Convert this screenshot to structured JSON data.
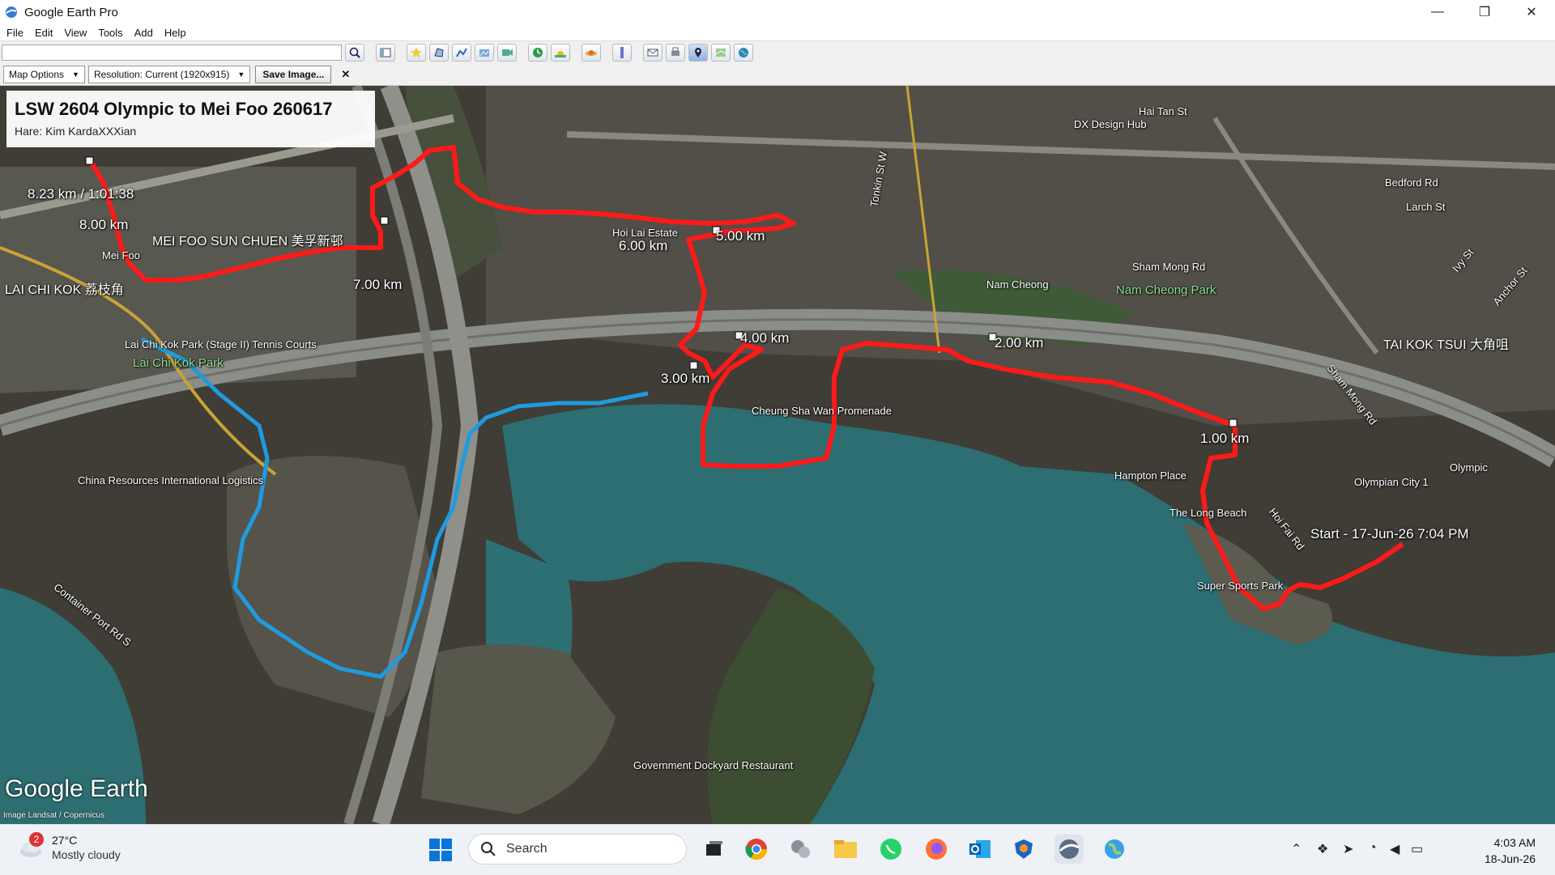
{
  "window": {
    "title": "Google Earth Pro",
    "controls": [
      "—",
      "❐",
      "✕"
    ]
  },
  "menu": [
    "File",
    "Edit",
    "View",
    "Tools",
    "Add",
    "Help"
  ],
  "toolbar": {
    "search_value": "",
    "buttons": [
      "search-icon",
      "sidebar-icon",
      "placemark-icon",
      "polygon-icon",
      "path-icon",
      "overlay-icon",
      "tour-icon",
      "history-icon",
      "sun-icon",
      "planets-icon",
      "ruler-icon",
      "email-icon",
      "print-icon",
      "save-image-icon",
      "maps-icon",
      "earth-icon"
    ]
  },
  "options": {
    "map_options_label": "Map Options",
    "resolution_label": "Resolution: Current (1920x915)",
    "save_label": "Save Image...",
    "close_label": "✕"
  },
  "infobox": {
    "title": "LSW 2604 Olympic to Mei Foo 260617",
    "subtitle": "Hare: Kim KardaXXXian"
  },
  "km_markers": [
    "8.23 km / 1:01:38",
    "8.00 km",
    "7.00 km",
    "6.00 km",
    "5.00 km",
    "4.00 km",
    "3.00 km",
    "2.00 km",
    "1.00 km",
    "Start - 17-Jun-26 7:04 PM"
  ],
  "map_labels": {
    "mei_foo_sun_chuen": "MEI FOO SUN CHUEN 美孚新邨",
    "mei_foo": "Mei Foo",
    "lai_chi_kok": "LAI CHI KOK 荔枝角",
    "lck_tennis": "Lai Chi Kok Park (Stage II) Tennis Courts",
    "lck_park": "Lai Chi Kok Park",
    "hoi_lai": "Hoi Lai Estate",
    "nam_cheong": "Nam Cheong",
    "nam_cheong_park": "Nam Cheong Park",
    "sham_mong": "Sham Mong Rd",
    "csw_promenade": "Cheung Sha Wan Promenade",
    "china_resources": "China Resources International Logistics",
    "container_port": "Container Port Rd S",
    "hampton": "Hampton Place",
    "long_beach": "The Long Beach",
    "super_sports": "Super Sports Park",
    "olympian_city": "Olympian City 1",
    "olympic": "Olympic",
    "tai_kok_tsui": "TAI KOK TSUI 大角咀",
    "bedford": "Bedford Rd",
    "larch": "Larch St",
    "dx_design": "DX Design Hub",
    "tai_tsun": "Hai Tan St",
    "govt_dockyard": "Government Dockyard Restaurant",
    "hoi_fai": "Hoi Fai Rd",
    "sham_mong_rd2": "Sham Mong Rd",
    "tonkin": "Tonkin St W",
    "anchor": "Anchor St",
    "ivy": "Ivy St"
  },
  "branding": {
    "logo": "Google Earth",
    "attribution": "Image Landsat / Copernicus"
  },
  "colors": {
    "route_red": "#ff1a1a",
    "route_blue": "#1e9be0",
    "water": "#2f6f73",
    "land": "#4b4a3f"
  },
  "taskbar": {
    "weather_badge": "2",
    "temperature": "27°C",
    "condition": "Mostly cloudy",
    "search_label": "Search",
    "time": "4:03 AM",
    "date": "18-Jun-26"
  }
}
